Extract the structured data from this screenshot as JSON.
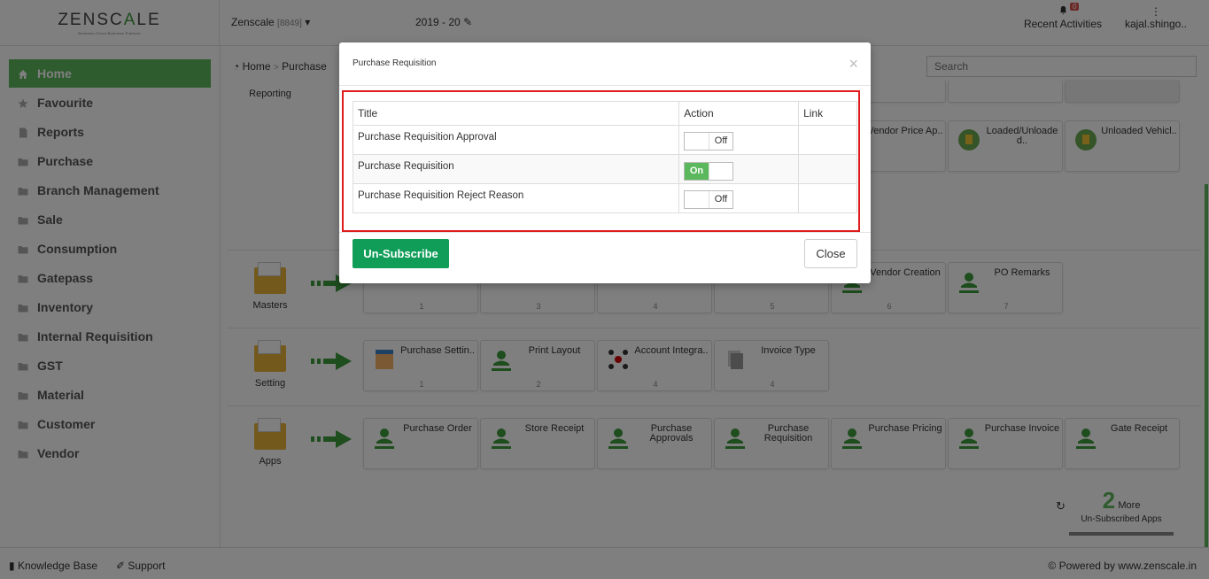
{
  "header": {
    "logo_text_a": "ZENSC",
    "logo_text_b": "A",
    "logo_text_c": "LE",
    "logo_tagline": "Business Cloud Business Platform",
    "company_name": "Zenscale",
    "company_code": "[8849]",
    "year": "2019 - 20",
    "notification_count": "0",
    "recent_label": "Recent Activities",
    "user_label": "kajal.shingo.."
  },
  "sidebar": {
    "items": [
      {
        "label": "Home"
      },
      {
        "label": "Favourite"
      },
      {
        "label": "Reports"
      },
      {
        "label": "Purchase"
      },
      {
        "label": "Branch Management"
      },
      {
        "label": "Sale"
      },
      {
        "label": "Consumption"
      },
      {
        "label": "Gatepass"
      },
      {
        "label": "Inventory"
      },
      {
        "label": "Internal Requisition"
      },
      {
        "label": "GST"
      },
      {
        "label": "Material"
      },
      {
        "label": "Customer"
      },
      {
        "label": "Vendor"
      }
    ]
  },
  "main": {
    "breadcrumb_home": "Home",
    "breadcrumb_sep": ">",
    "breadcrumb_purchase": "Purchase",
    "search_placeholder": "Search",
    "rows": {
      "reporting": "Reporting",
      "masters": "Masters",
      "setting": "Setting",
      "apps": "Apps"
    },
    "reporting_cards": [
      {
        "title": "Vendor Price Ap.."
      },
      {
        "title": "Loaded/Unloade d.."
      },
      {
        "title": "Unloaded Vehicl.."
      }
    ],
    "masters_cards": [
      {
        "title": "",
        "num": "1"
      },
      {
        "title": "",
        "num": "3"
      },
      {
        "title": "",
        "num": "4"
      },
      {
        "title": "",
        "num": "5"
      },
      {
        "title": "Vendor Creation",
        "num": "6"
      },
      {
        "title": "PO Remarks",
        "num": "7"
      }
    ],
    "setting_cards": [
      {
        "title": "Purchase Settin..",
        "num": "1"
      },
      {
        "title": "Print Layout",
        "num": "2"
      },
      {
        "title": "Account Integra..",
        "num": "4"
      },
      {
        "title": "Invoice Type",
        "num": "4"
      }
    ],
    "apps_cards": [
      {
        "title": "Purchase Order"
      },
      {
        "title": "Store Receipt"
      },
      {
        "title": "Purchase Approvals"
      },
      {
        "title": "Purchase Requisition"
      },
      {
        "title": "Purchase Pricing"
      },
      {
        "title": "Purchase Invoice"
      },
      {
        "title": "Gate Receipt"
      }
    ],
    "more_count": "2",
    "more_word": "More",
    "more_sub": "Un-Subscribed Apps"
  },
  "footer": {
    "knowledge_base": "Knowledge Base",
    "support": "Support",
    "powered_by": "© Powered by www.zenscale.in"
  },
  "modal": {
    "title": "Purchase Requisition",
    "close_symbol": "×",
    "col_title": "Title",
    "col_action": "Action",
    "col_link": "Link",
    "rows": [
      {
        "title": "Purchase Requisition Approval",
        "state": "Off"
      },
      {
        "title": "Purchase Requisition",
        "state": "On"
      },
      {
        "title": "Purchase Requisition Reject Reason",
        "state": "Off"
      }
    ],
    "unsubscribe_label": "Un-Subscribe",
    "close_label": "Close"
  },
  "colors": {
    "brand_green": "#5cb85c",
    "unsubscribe_green": "#0f9d58",
    "highlight_red": "#e01b1b"
  }
}
